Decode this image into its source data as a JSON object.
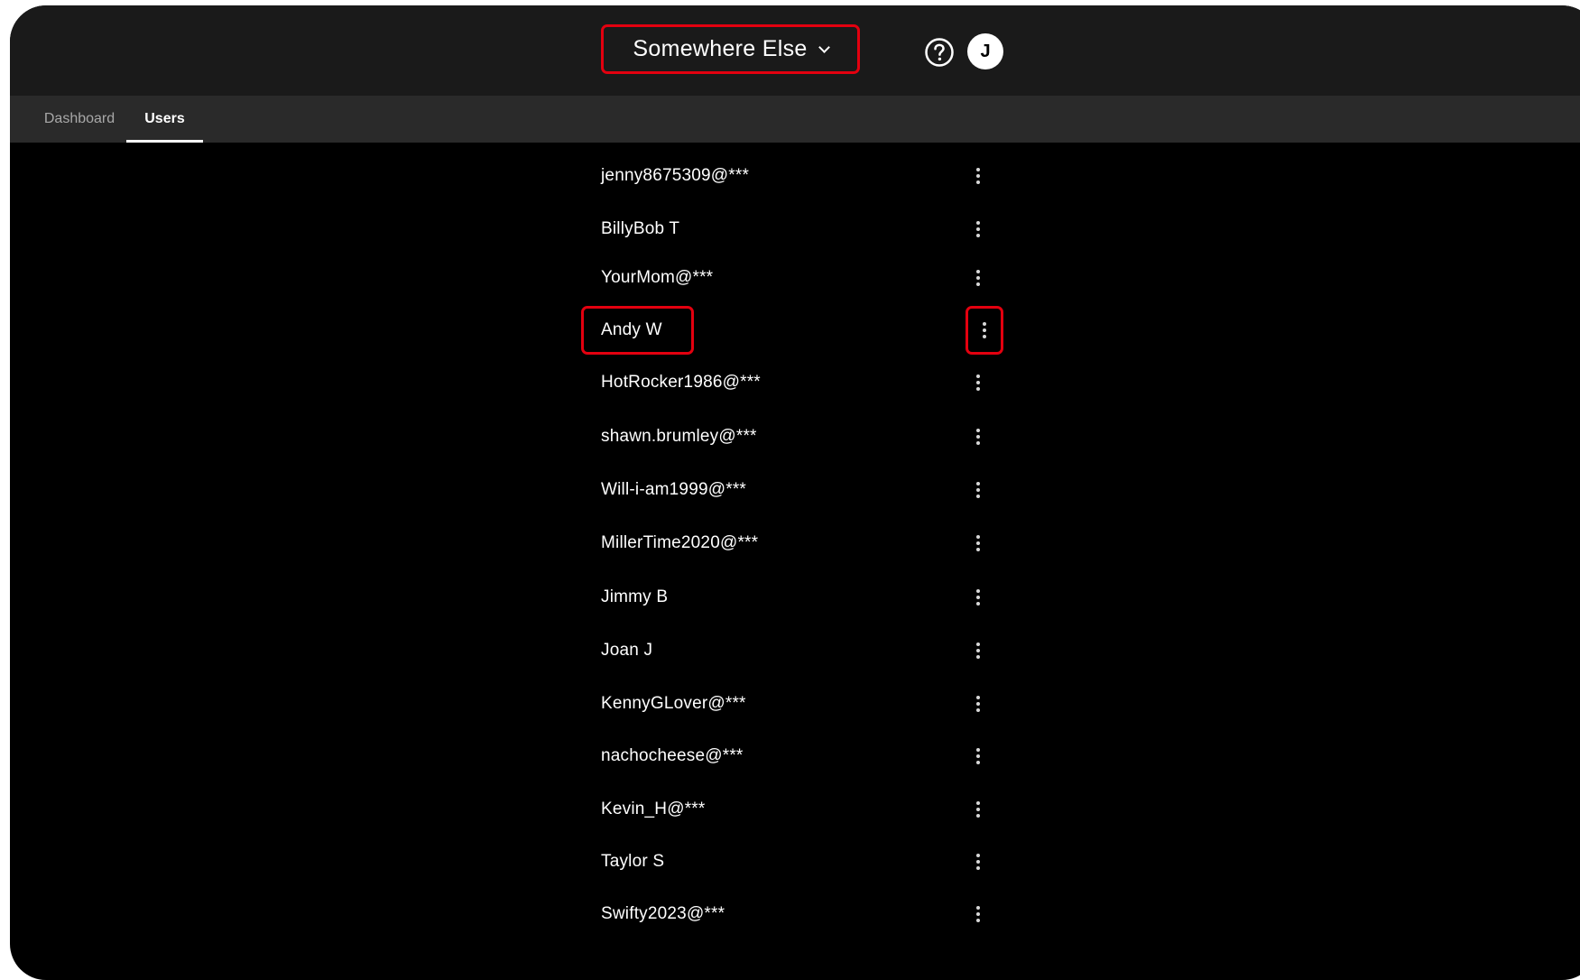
{
  "header": {
    "location_label": "Somewhere Else",
    "help_icon": "question-circle-icon",
    "avatar_initial": "J"
  },
  "tabs": [
    {
      "label": "Dashboard",
      "active": false
    },
    {
      "label": "Users",
      "active": true
    }
  ],
  "users": [
    {
      "name": "jenny8675309@***"
    },
    {
      "name": "BillyBob T"
    },
    {
      "name": "YourMom@***"
    },
    {
      "name": "Andy W"
    },
    {
      "name": "HotRocker1986@***"
    },
    {
      "name": "shawn.brumley@***"
    },
    {
      "name": "Will-i-am1999@***"
    },
    {
      "name": "MillerTime2020@***"
    },
    {
      "name": "Jimmy B"
    },
    {
      "name": "Joan J"
    },
    {
      "name": "KennyGLover@***"
    },
    {
      "name": "nachocheese@***"
    },
    {
      "name": "Kevin_H@***"
    },
    {
      "name": "Taylor S"
    },
    {
      "name": "Swifty2023@***"
    }
  ],
  "highlighted_user": "Andy W",
  "colors": {
    "highlight": "#e3000f",
    "background": "#000000",
    "topbar": "#1a1a1a",
    "tabbar": "#2a2a2a"
  }
}
